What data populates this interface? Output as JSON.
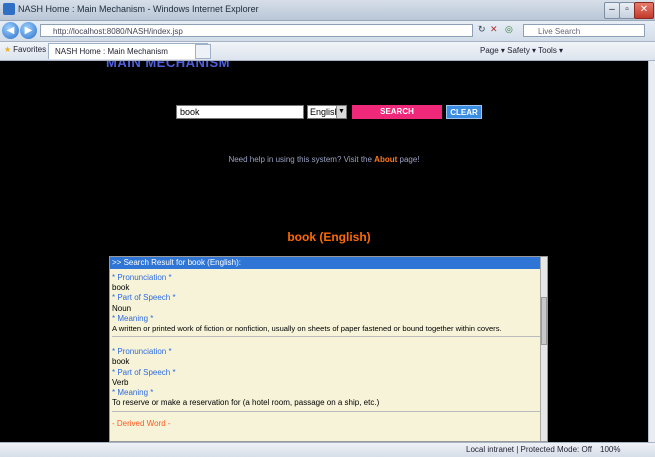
{
  "browser": {
    "window_title": "NASH Home : Main Mechanism - Windows Internet Explorer",
    "address": "http://localhost:8080/NASH/index.jsp",
    "search_placeholder": "Live Search",
    "favorites_label": "Favorites",
    "tab_title": "NASH Home : Main Mechanism",
    "toolbar_tools": "Page ▾  Safety ▾  Tools ▾",
    "status_zone": "Local intranet | Protected Mode: Off",
    "zoom": "100%"
  },
  "page": {
    "heading": "MAIN MECHANISM",
    "search_value": "book",
    "language_selected": "English",
    "search_button": "SEARCH",
    "clear_button": "CLEAR",
    "help_prefix": "Need help in using this system? Visit the ",
    "help_link": "About",
    "help_suffix": " page!",
    "result_title": "book (English)"
  },
  "result": {
    "header": ">> Search Result for book (English):",
    "entries": [
      {
        "pron_label": "* Pronunciation *",
        "pron": "book",
        "pos_label": "* Part of Speech *",
        "pos": "Noun",
        "meaning_label": "* Meaning *",
        "meaning": "A written or printed work of fiction or nonfiction, usually on sheets of paper fastened or bound together within covers."
      },
      {
        "pron_label": "* Pronunciation *",
        "pron": "book",
        "pos_label": "* Part of Speech *",
        "pos": "Verb",
        "meaning_label": "* Meaning *",
        "meaning": "To reserve or make a reservation for (a hotel room, passage on a ship, etc.)"
      }
    ],
    "derived_label": "- Derived Word -"
  }
}
